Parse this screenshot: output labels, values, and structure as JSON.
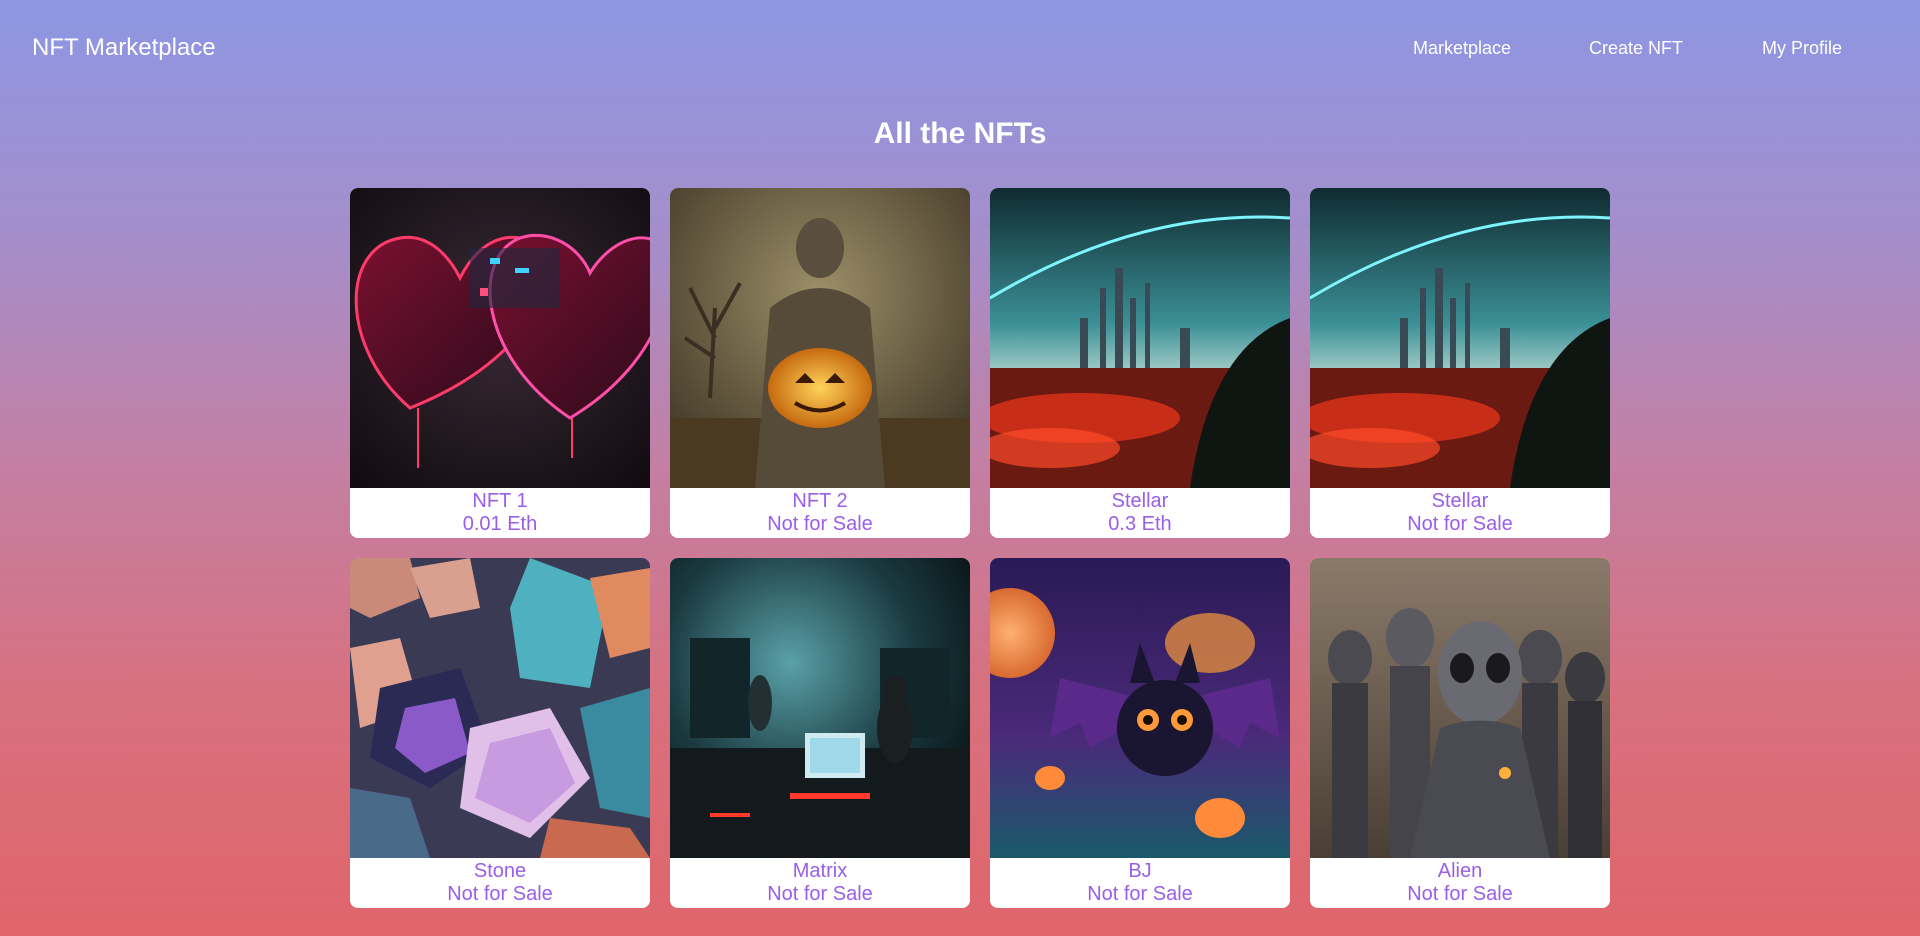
{
  "navbar": {
    "brand": "NFT Marketplace",
    "links": [
      "Marketplace",
      "Create NFT",
      "My Profile"
    ]
  },
  "page": {
    "title": "All the NFTs"
  },
  "nfts": [
    {
      "name": "NFT 1",
      "price": "0.01 Eth",
      "image": "neon-hearts"
    },
    {
      "name": "NFT 2",
      "price": "Not for Sale",
      "image": "pumpkin-scarecrow"
    },
    {
      "name": "Stellar",
      "price": "0.3 Eth",
      "image": "futuristic-city"
    },
    {
      "name": "Stellar",
      "price": "Not for Sale",
      "image": "futuristic-city"
    },
    {
      "name": "Stone",
      "price": "Not for Sale",
      "image": "crystal-stones"
    },
    {
      "name": "Matrix",
      "price": "Not for Sale",
      "image": "dark-computer-room"
    },
    {
      "name": "BJ",
      "price": "Not for Sale",
      "image": "cute-bat"
    },
    {
      "name": "Alien",
      "price": "Not for Sale",
      "image": "alien-crowd"
    }
  ],
  "colors": {
    "gradient_top": "#8d96e3",
    "gradient_bottom": "#e0656a",
    "caption_text": "#9a5ee8"
  }
}
